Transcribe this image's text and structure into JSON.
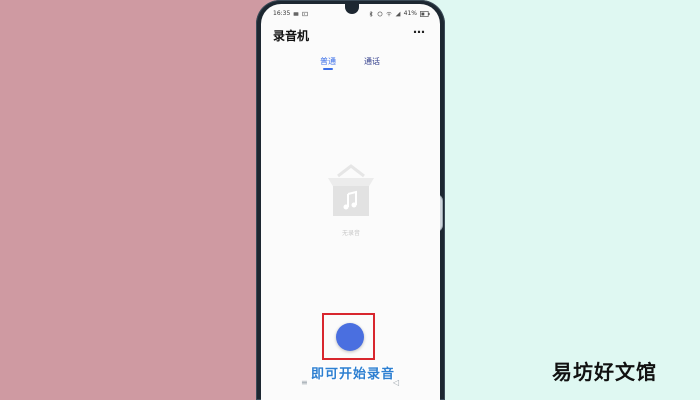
{
  "status_bar": {
    "time": "16:35",
    "battery": "41%",
    "icons": [
      "notification-icon",
      "photo-icon",
      "bluetooth-icon",
      "alarm-icon",
      "wifi-icon",
      "signal-icon",
      "battery-icon"
    ]
  },
  "header": {
    "title": "录音机",
    "more_label": "⋯"
  },
  "tabs": [
    {
      "label": "普通",
      "active": true
    },
    {
      "label": "通话",
      "active": false
    }
  ],
  "empty_state": {
    "label": "无录音",
    "icon": "music-box-icon"
  },
  "record": {
    "icon": "record-button",
    "color": "#4a6fe0",
    "highlight_color": "#d8262e"
  },
  "caption": "即可开始录音",
  "watermark": "易坊好文馆",
  "nav": {
    "menu_icon": "≡",
    "back_icon": "◁"
  }
}
